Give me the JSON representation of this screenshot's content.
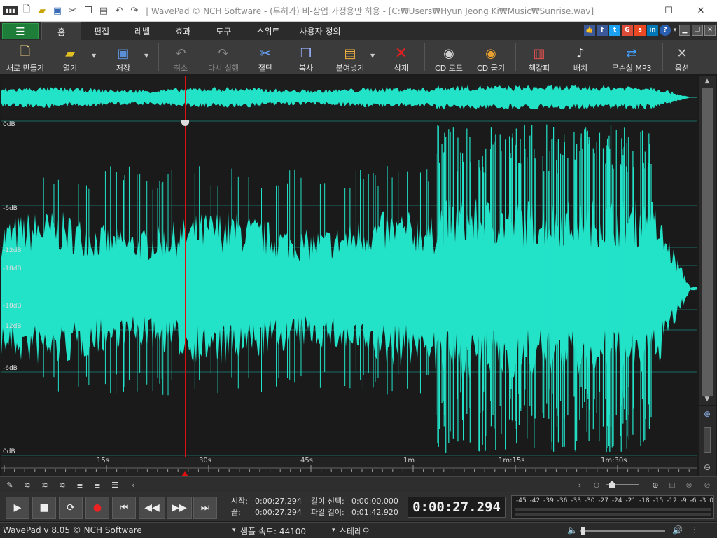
{
  "window": {
    "title": "| WavePad © NCH Software - (무허가) 비-상업 가정용만 허용 - [C:₩Users₩Hyun Jeong Ki₩Music₩Sunrise.wav]",
    "minimize": "—",
    "maximize": "☐",
    "close": "✕"
  },
  "tabs": [
    "홈",
    "편집",
    "레벨",
    "효과",
    "도구",
    "스위트",
    "사용자 정의"
  ],
  "toolbar": {
    "new": "새로 만들기",
    "open": "열기",
    "save": "저장",
    "undo": "취소",
    "redo": "다시 실행",
    "cut": "절단",
    "copy": "복사",
    "paste": "붙여넣기",
    "delete": "삭제",
    "cd_load": "CD 로드",
    "cd_burn": "CD 굽기",
    "bookmark": "책갈피",
    "batch": "배치",
    "lossless_mp3": "무손실 MP3",
    "options": "옵션"
  },
  "waveform": {
    "db_labels": [
      "0dB",
      "-6dB",
      "-12dB",
      "-18dB",
      "-18dB",
      "-12dB",
      "-6dB",
      "0dB"
    ],
    "color": "#22e3c8"
  },
  "timeline": {
    "labels": [
      "15s",
      "30s",
      "45s",
      "1m",
      "1m:15s",
      "1m:30s"
    ]
  },
  "transport": {
    "start_label": "시작:",
    "start_value": "0:00:27.294",
    "end_label": "끝:",
    "end_value": "0:00:27.294",
    "sel_len_label": "길이 선택:",
    "sel_len_value": "0:00:00.000",
    "file_len_label": "파일 길이:",
    "file_len_value": "0:01:42.920",
    "current_time": "0:00:27.294",
    "meter_scale": "-45 -42 -39 -36 -33 -30 -27 -24 -21 -18 -15 -12 -9 -6 -3 0"
  },
  "status": {
    "version": "WavePad v 8.05 © NCH Software",
    "sample_rate": "샘플 속도: 44100",
    "channels": "스테레오"
  }
}
